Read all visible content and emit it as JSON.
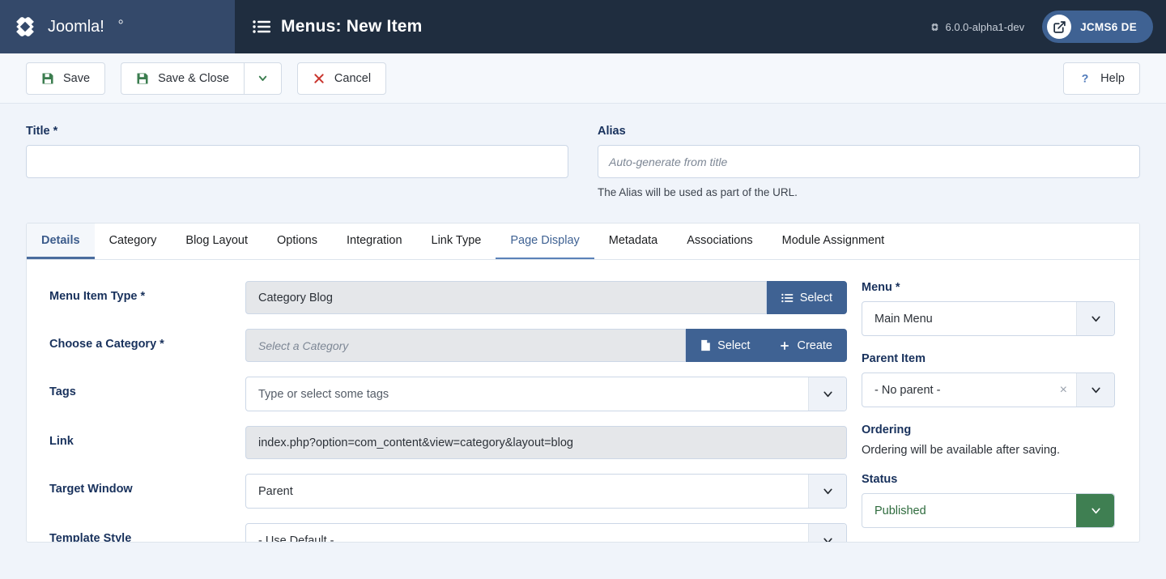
{
  "header": {
    "brand_name": "Joomla!",
    "title": "Menus: New Item",
    "version": "6.0.0-alpha1-dev",
    "site_label": "JCMS6 DE"
  },
  "toolbar": {
    "save_label": "Save",
    "save_close_label": "Save & Close",
    "cancel_label": "Cancel",
    "help_label": "Help"
  },
  "top_fields": {
    "title_label": "Title *",
    "title_value": "",
    "alias_label": "Alias",
    "alias_placeholder": "Auto-generate from title",
    "alias_help": "The Alias will be used as part of the URL."
  },
  "tabs": [
    {
      "label": "Details",
      "state": "active"
    },
    {
      "label": "Category",
      "state": "normal"
    },
    {
      "label": "Blog Layout",
      "state": "normal"
    },
    {
      "label": "Options",
      "state": "normal"
    },
    {
      "label": "Integration",
      "state": "normal"
    },
    {
      "label": "Link Type",
      "state": "normal"
    },
    {
      "label": "Page Display",
      "state": "hover"
    },
    {
      "label": "Metadata",
      "state": "normal"
    },
    {
      "label": "Associations",
      "state": "normal"
    },
    {
      "label": "Module Assignment",
      "state": "normal"
    }
  ],
  "details": {
    "menu_item_type_label": "Menu Item Type *",
    "menu_item_type_value": "Category Blog",
    "menu_item_type_select": "Select",
    "choose_category_label": "Choose a Category *",
    "choose_category_placeholder": "Select a Category",
    "choose_category_select": "Select",
    "choose_category_create": "Create",
    "tags_label": "Tags",
    "tags_placeholder": "Type or select some tags",
    "link_label": "Link",
    "link_value": "index.php?option=com_content&view=category&layout=blog",
    "target_window_label": "Target Window",
    "target_window_value": "Parent",
    "template_style_label": "Template Style",
    "template_style_value": "- Use Default -"
  },
  "sidebar": {
    "menu_label": "Menu *",
    "menu_value": "Main Menu",
    "parent_item_label": "Parent Item",
    "parent_item_value": "- No parent -",
    "ordering_label": "Ordering",
    "ordering_note": "Ordering will be available after saving.",
    "status_label": "Status",
    "status_value": "Published"
  },
  "colors": {
    "header_bg": "#1f2d3f",
    "brand_bg": "#34496a",
    "accent_blue": "#3f6293",
    "status_green": "#3f7f52",
    "save_green": "#3b7d4f",
    "cancel_red": "#c9342c"
  }
}
